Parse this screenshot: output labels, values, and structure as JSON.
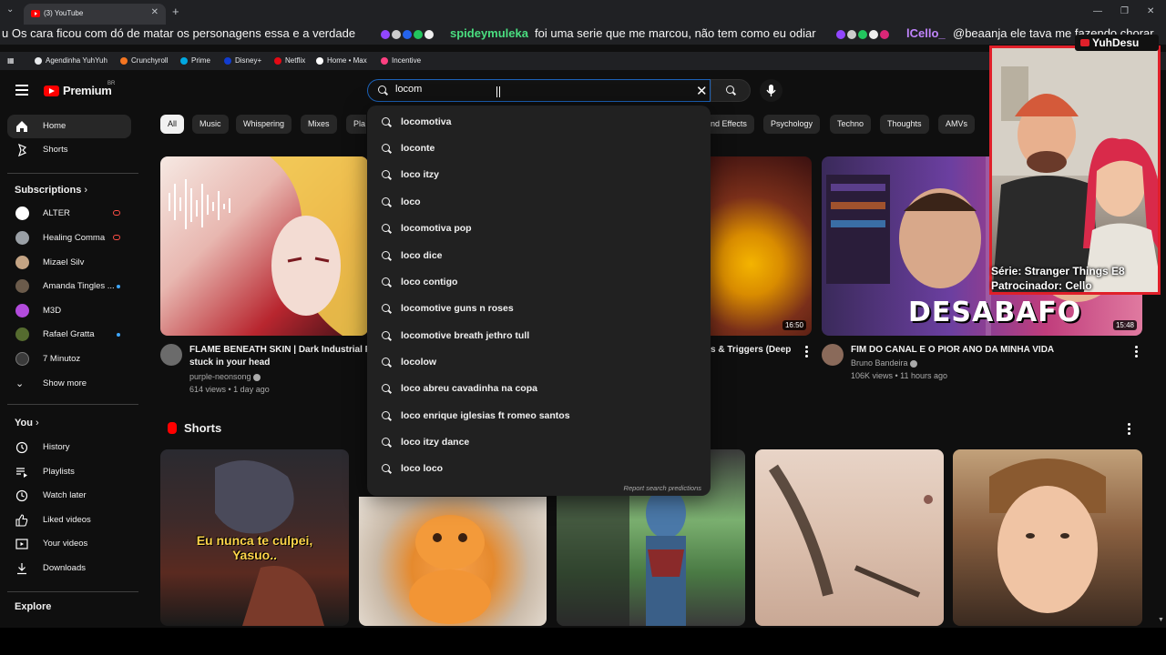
{
  "browser": {
    "tab_title": "(3) YouTube",
    "url_ghost": "youtube.com",
    "bookmarks": [
      {
        "label": "Agendinha YuhYuh",
        "color": "#e8eaed"
      },
      {
        "label": "Crunchyroll",
        "color": "#f47521"
      },
      {
        "label": "Prime",
        "color": "#00a8e1"
      },
      {
        "label": "Disney+",
        "color": "#113ccf"
      },
      {
        "label": "Netflix",
        "color": "#e50914"
      },
      {
        "label": "Home • Max",
        "color": "#ffffff"
      },
      {
        "label": "Incentive",
        "color": "#ff4081"
      }
    ]
  },
  "ticker": {
    "msg1": "u  Os cara ficou com dó de matar os personagens essa e a verdade",
    "user2": "spideymuleka",
    "msg2": "foi uma serie que me marcou, não tem como eu odiar",
    "user3": "lCello_",
    "msg3": "@beaanja ele tava me fazendo chorar"
  },
  "header": {
    "logo_text": "Premium",
    "country": "BR"
  },
  "search": {
    "value": "locom",
    "placeholder": "Search",
    "suggestions": [
      "locomotiva",
      "loconte",
      "loco itzy",
      "loco",
      "locomotiva pop",
      "loco dice",
      "loco contigo",
      "locomotive guns n roses",
      "locomotive breath jethro tull",
      "locolow",
      "loco abreu cavadinha na copa",
      "loco enrique iglesias ft romeo santos",
      "loco itzy dance",
      "loco loco"
    ],
    "report": "Report search predictions"
  },
  "sidebar": {
    "home": "Home",
    "shorts": "Shorts",
    "subscriptions_title": "Subscriptions",
    "subscriptions": [
      {
        "name": "ALTER",
        "live": true,
        "color": "#ffffff"
      },
      {
        "name": "Healing Comma",
        "live": true,
        "color": "#9aa0a6"
      },
      {
        "name": "Mizael Silv",
        "live": false,
        "color": "#c4a484"
      },
      {
        "name": "Amanda Tingles ...",
        "live": false,
        "dot": true,
        "color": "#6b5b4b"
      },
      {
        "name": "M3D",
        "live": false,
        "color": "#b24bdc"
      },
      {
        "name": "Rafael Gratta",
        "live": false,
        "dot": true,
        "color": "#556b2f"
      },
      {
        "name": "7 Minutoz",
        "live": false,
        "color": "#3a3a3a"
      }
    ],
    "show_more": "Show more",
    "you_title": "You",
    "you": [
      "History",
      "Playlists",
      "Watch later",
      "Liked videos",
      "Your videos",
      "Downloads"
    ],
    "explore_title": "Explore"
  },
  "chips": [
    "All",
    "Music",
    "Whispering",
    "Mixes",
    "Pla",
    "nd Effects",
    "Psychology",
    "Techno",
    "Thoughts",
    "AMVs"
  ],
  "videos": [
    {
      "title_l1": "FLAME BENEATH SKIN | Dark Industrial F",
      "title_l2": "stuck in your head",
      "channel": "purple-neonsong",
      "meta": "614 views • 1 day ago"
    },
    {
      "title": "s & Triggers (Deep",
      "duration": "16:50"
    },
    {
      "title": "FIM DO CANAL E O PIOR ANO DA MINHA VIDA",
      "channel": "Bruno Bandeira",
      "meta": "106K views • 11 hours ago",
      "duration": "15:48",
      "thumb_text": "DESABAFO"
    }
  ],
  "shorts": {
    "title": "Shorts",
    "caption1": "Eu nunca te culpei, Yasuo.."
  },
  "overlay": {
    "brand": "YuhDesu",
    "caption_l1": "Série: Stranger Things E8",
    "caption_l2": "Patrocinador: Cello"
  }
}
